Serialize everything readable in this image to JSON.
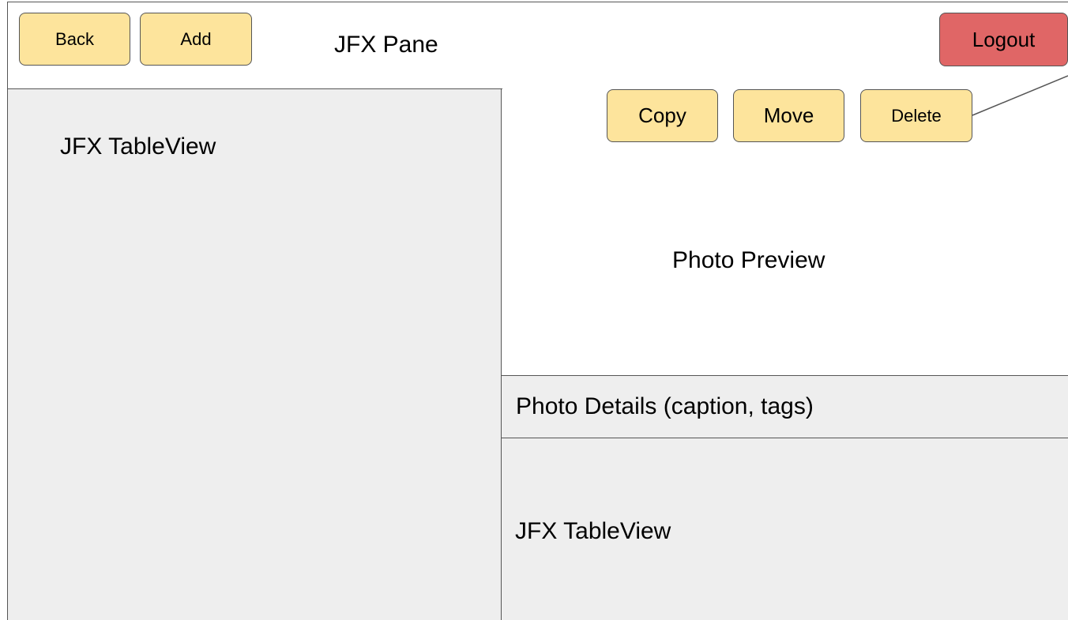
{
  "header": {
    "back_label": "Back",
    "add_label": "Add",
    "pane_label": "JFX Pane",
    "logout_label": "Logout"
  },
  "left_panel": {
    "label": "JFX TableView"
  },
  "actions": {
    "copy_label": "Copy",
    "move_label": "Move",
    "delete_label": "Delete"
  },
  "preview": {
    "label": "Photo Preview"
  },
  "details": {
    "label": "Photo Details (caption, tags)"
  },
  "bottom_table": {
    "label": "JFX TableView"
  },
  "colors": {
    "button_fill": "#fde49c",
    "logout_fill": "#e06666",
    "panel_fill": "#eeeeee",
    "border": "#555555"
  }
}
